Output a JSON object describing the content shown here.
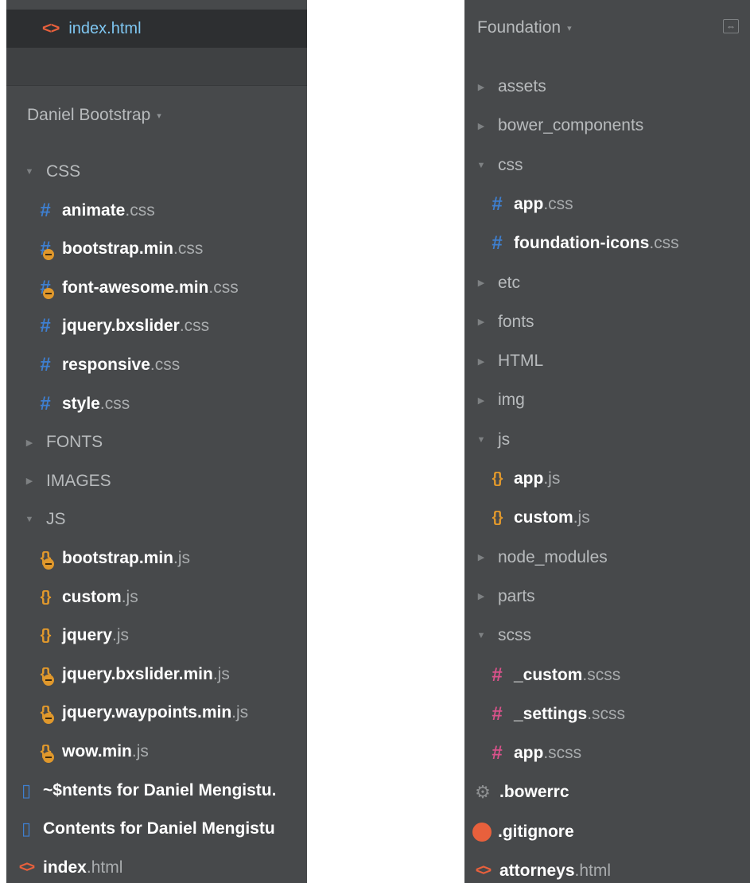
{
  "left_panel": {
    "open_file": {
      "icon": "html-icon",
      "name": "index.html"
    },
    "project": {
      "name": "Daniel Bootstrap",
      "caret": "▾"
    },
    "tree": [
      {
        "type": "folder",
        "name": "CSS",
        "expanded": true
      },
      {
        "type": "file",
        "icon": "css",
        "base": "animate",
        "ext": ".css"
      },
      {
        "type": "file",
        "icon": "css",
        "locked": true,
        "base": "bootstrap.min",
        "ext": ".css"
      },
      {
        "type": "file",
        "icon": "css",
        "locked": true,
        "base": "font-awesome.min",
        "ext": ".css"
      },
      {
        "type": "file",
        "icon": "css",
        "base": "jquery.bxslider",
        "ext": ".css"
      },
      {
        "type": "file",
        "icon": "css",
        "base": "responsive",
        "ext": ".css"
      },
      {
        "type": "file",
        "icon": "css",
        "base": "style",
        "ext": ".css"
      },
      {
        "type": "folder",
        "name": "FONTS",
        "expanded": false
      },
      {
        "type": "folder",
        "name": "IMAGES",
        "expanded": false
      },
      {
        "type": "folder",
        "name": "JS",
        "expanded": true
      },
      {
        "type": "file",
        "icon": "js",
        "locked": true,
        "base": "bootstrap.min",
        "ext": ".js"
      },
      {
        "type": "file",
        "icon": "js",
        "base": "custom",
        "ext": ".js"
      },
      {
        "type": "file",
        "icon": "js",
        "base": "jquery",
        "ext": ".js"
      },
      {
        "type": "file",
        "icon": "js",
        "locked": true,
        "base": "jquery.bxslider.min",
        "ext": ".js"
      },
      {
        "type": "file",
        "icon": "js",
        "locked": true,
        "base": "jquery.waypoints.min",
        "ext": ".js"
      },
      {
        "type": "file",
        "icon": "js",
        "locked": true,
        "base": "wow.min",
        "ext": ".js"
      },
      {
        "type": "file",
        "icon": "doc",
        "root": true,
        "base": "~$ntents for Daniel Mengistu.",
        "ext": ""
      },
      {
        "type": "file",
        "icon": "doc",
        "root": true,
        "base": "Contents for Daniel Mengistu",
        "ext": ""
      },
      {
        "type": "file",
        "icon": "html",
        "root": true,
        "base": "index",
        "ext": ".html"
      }
    ]
  },
  "right_panel": {
    "project": {
      "name": "Foundation",
      "caret": "▾"
    },
    "sync_icon": "⇔",
    "tree": [
      {
        "type": "folder",
        "name": "assets",
        "expanded": false
      },
      {
        "type": "folder",
        "name": "bower_components",
        "expanded": false
      },
      {
        "type": "folder",
        "name": "css",
        "expanded": true
      },
      {
        "type": "file",
        "icon": "css",
        "base": "app",
        "ext": ".css"
      },
      {
        "type": "file",
        "icon": "css",
        "base": "foundation-icons",
        "ext": ".css"
      },
      {
        "type": "folder",
        "name": "etc",
        "expanded": false
      },
      {
        "type": "folder",
        "name": "fonts",
        "expanded": false
      },
      {
        "type": "folder",
        "name": "HTML",
        "expanded": false
      },
      {
        "type": "folder",
        "name": "img",
        "expanded": false
      },
      {
        "type": "folder",
        "name": "js",
        "expanded": true
      },
      {
        "type": "file",
        "icon": "js",
        "base": "app",
        "ext": ".js"
      },
      {
        "type": "file",
        "icon": "js",
        "base": "custom",
        "ext": ".js"
      },
      {
        "type": "folder",
        "name": "node_modules",
        "expanded": false
      },
      {
        "type": "folder",
        "name": "parts",
        "expanded": false
      },
      {
        "type": "folder",
        "name": "scss",
        "expanded": true
      },
      {
        "type": "file",
        "icon": "scss",
        "base": "_custom",
        "ext": ".scss"
      },
      {
        "type": "file",
        "icon": "scss",
        "base": "_settings",
        "ext": ".scss"
      },
      {
        "type": "file",
        "icon": "scss",
        "base": "app",
        "ext": ".scss"
      },
      {
        "type": "file",
        "icon": "gear",
        "root": true,
        "base": ".bowerrc",
        "ext": ""
      },
      {
        "type": "file",
        "icon": "git",
        "root": true,
        "base": ".gitignore",
        "ext": ""
      },
      {
        "type": "file",
        "icon": "html",
        "root": true,
        "base": "attorneys",
        "ext": ".html"
      }
    ]
  },
  "icon_glyphs": {
    "css": "#",
    "scss": "#",
    "js": "{}",
    "html": "<>",
    "gear": "⚙",
    "doc": "▯",
    "folder_expanded": "▼",
    "folder_collapsed": "▶"
  }
}
